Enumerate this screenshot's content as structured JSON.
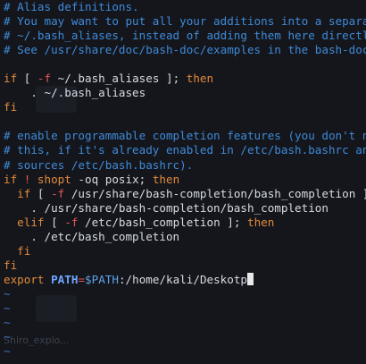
{
  "background": {
    "captions": [
      "Shiro_explo..."
    ]
  },
  "editor": {
    "lines": [
      [
        {
          "t": "# Alias definitions.",
          "c": "c-comment"
        }
      ],
      [
        {
          "t": "# You may want to put all your additions into a separate file like",
          "c": "c-comment"
        }
      ],
      [
        {
          "t": "# ~/.bash_aliases, instead of adding them here directly.",
          "c": "c-comment"
        }
      ],
      [
        {
          "t": "# See /usr/share/doc/bash-doc/examples in the bash-doc package.",
          "c": "c-comment"
        }
      ],
      [],
      [
        {
          "t": "if",
          "c": "c-kw"
        },
        {
          "t": " [ ",
          "c": "c-str"
        },
        {
          "t": "-f",
          "c": "c-op"
        },
        {
          "t": " ~/.bash_aliases ",
          "c": "c-str"
        },
        {
          "t": "];",
          "c": "c-str"
        },
        {
          "t": " then",
          "c": "c-kw"
        }
      ],
      [
        {
          "t": "    . ~/.bash_aliases",
          "c": "c-str"
        }
      ],
      [
        {
          "t": "fi",
          "c": "c-kw"
        }
      ],
      [],
      [
        {
          "t": "# enable programmable completion features (you don't need to enable",
          "c": "c-comment"
        }
      ],
      [
        {
          "t": "# this, if it's already enabled in /etc/bash.bashrc and /etc/profile",
          "c": "c-comment"
        }
      ],
      [
        {
          "t": "# sources /etc/bash.bashrc).",
          "c": "c-comment"
        }
      ],
      [
        {
          "t": "if",
          "c": "c-kw"
        },
        {
          "t": " ! ",
          "c": "c-op"
        },
        {
          "t": "shopt",
          "c": "c-kw"
        },
        {
          "t": " -oq posix; ",
          "c": "c-str"
        },
        {
          "t": "then",
          "c": "c-kw"
        }
      ],
      [
        {
          "t": "  if",
          "c": "c-kw"
        },
        {
          "t": " [ ",
          "c": "c-str"
        },
        {
          "t": "-f",
          "c": "c-op"
        },
        {
          "t": " /usr/share/bash-completion/bash_completion ]; then",
          "c": "c-str"
        }
      ],
      [
        {
          "t": "    . /usr/share/bash-completion/bash_completion",
          "c": "c-str"
        }
      ],
      [
        {
          "t": "  elif",
          "c": "c-kw"
        },
        {
          "t": " [ ",
          "c": "c-str"
        },
        {
          "t": "-f",
          "c": "c-op"
        },
        {
          "t": " /etc/bash_completion ",
          "c": "c-str"
        },
        {
          "t": "];",
          "c": "c-str"
        },
        {
          "t": " then",
          "c": "c-kw"
        }
      ],
      [
        {
          "t": "    . /etc/bash_completion",
          "c": "c-str"
        }
      ],
      [
        {
          "t": "  fi",
          "c": "c-kw"
        }
      ],
      [
        {
          "t": "fi",
          "c": "c-kw"
        }
      ],
      [
        {
          "t": "export",
          "c": "c-kw"
        },
        {
          "t": " ",
          "c": "c-str"
        },
        {
          "t": "PATH",
          "c": "c-bold-var"
        },
        {
          "t": "=",
          "c": "c-eq"
        },
        {
          "t": "$PATH",
          "c": "c-var"
        },
        {
          "t": ":/home/kali/Deskotp",
          "c": "c-str"
        },
        {
          "t": "",
          "c": "cursor"
        }
      ],
      [
        {
          "t": "~",
          "c": "c-tilde"
        }
      ],
      [
        {
          "t": "~",
          "c": "c-tilde"
        }
      ],
      [
        {
          "t": "~",
          "c": "c-tilde"
        }
      ],
      [
        {
          "t": "~",
          "c": "c-tilde"
        }
      ],
      [
        {
          "t": "~",
          "c": "c-tilde"
        }
      ]
    ]
  }
}
